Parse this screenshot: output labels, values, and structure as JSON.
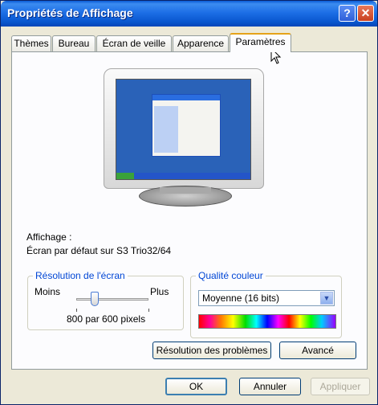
{
  "window": {
    "title": "Propriétés de Affichage",
    "help_glyph": "?",
    "close_glyph": "✕"
  },
  "tabs": [
    {
      "label": "Thèmes"
    },
    {
      "label": "Bureau"
    },
    {
      "label": "Écran de veille"
    },
    {
      "label": "Apparence"
    },
    {
      "label": "Paramètres",
      "active": true
    }
  ],
  "display": {
    "label": "Affichage :",
    "device": "Écran par défaut sur S3 Trio32/64"
  },
  "resolution": {
    "legend": "Résolution de l'écran",
    "less_label": "Moins",
    "more_label": "Plus",
    "value_text": "800 par 600 pixels",
    "slider_level": 0.25
  },
  "color_quality": {
    "legend": "Qualité couleur",
    "selected": "Moyenne (16 bits)"
  },
  "buttons": {
    "troubleshoot": "Résolution des problèmes",
    "advanced": "Avancé",
    "ok": "OK",
    "cancel": "Annuler",
    "apply": "Appliquer"
  },
  "colors": {
    "title_bar": "#0a58d0",
    "accent_tab": "#e5a31a",
    "legend_text": "#0046d5"
  }
}
